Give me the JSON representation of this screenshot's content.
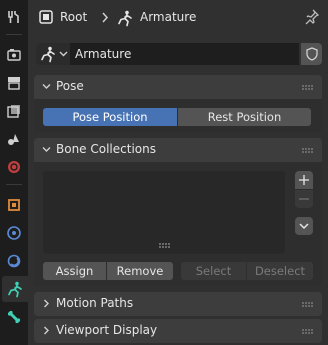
{
  "header": {
    "root_label": "Root",
    "object_label": "Armature"
  },
  "datablock": {
    "name": "Armature"
  },
  "panels": {
    "pose": {
      "title": "Pose",
      "pose_position_label": "Pose Position",
      "rest_position_label": "Rest Position",
      "active": "Pose Position"
    },
    "bone_collections": {
      "title": "Bone Collections",
      "assign_label": "Assign",
      "remove_label": "Remove",
      "select_label": "Select",
      "deselect_label": "Deselect"
    },
    "motion_paths": {
      "title": "Motion Paths"
    },
    "viewport_display": {
      "title": "Viewport Display"
    }
  },
  "tabs": [
    "tool-icon",
    "render-icon",
    "output-icon",
    "view-layer-icon",
    "scene-icon",
    "world-icon",
    "object-icon",
    "modifiers-icon",
    "physics-icon",
    "object-data-armature-icon",
    "bone-icon"
  ],
  "colors": {
    "accent_blue": "#4772b3",
    "active_tab_icon": "#3fd0b6",
    "background": "#303030"
  }
}
